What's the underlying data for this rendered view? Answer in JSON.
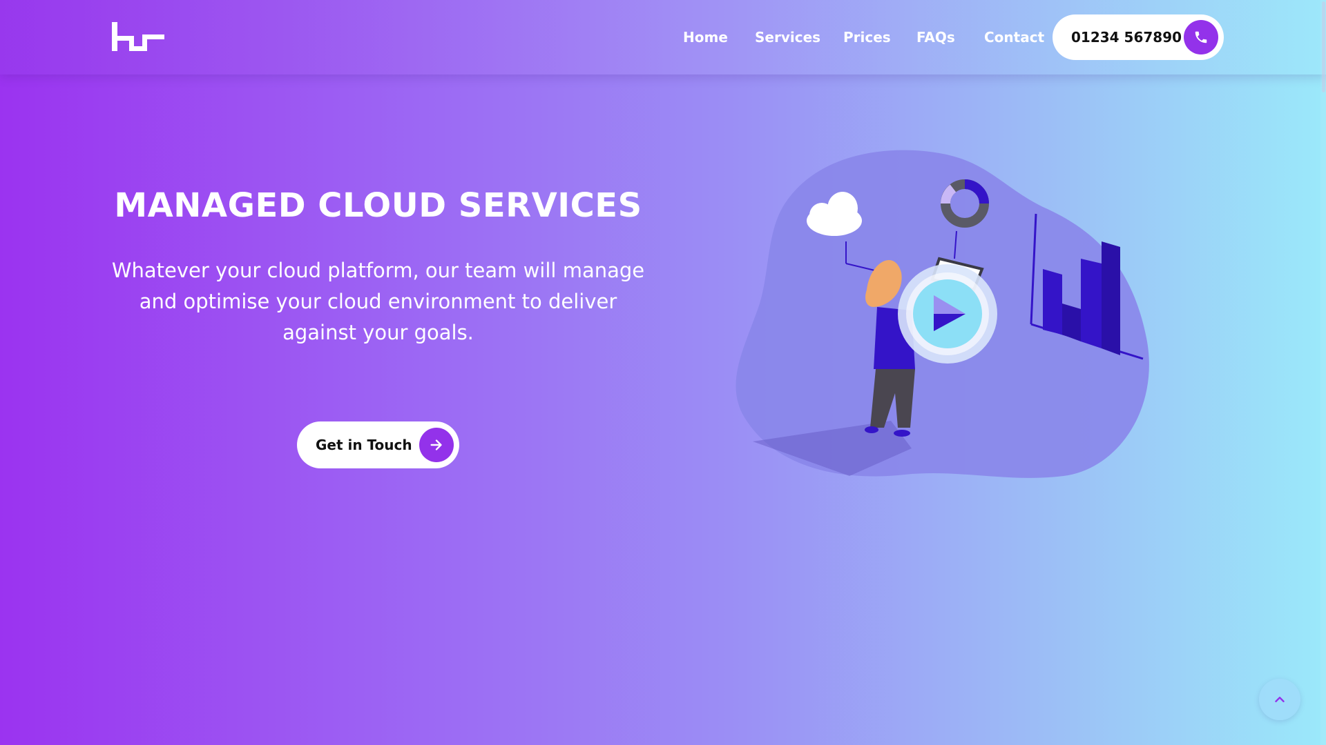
{
  "brand": {
    "logo_icon": "brand-logo-icon"
  },
  "nav": {
    "items": [
      {
        "label": "Home"
      },
      {
        "label": "Services"
      },
      {
        "label": "Prices"
      },
      {
        "label": "FAQs"
      },
      {
        "label": "Contact"
      }
    ],
    "phone": {
      "number": "01234 567890",
      "icon": "phone-icon"
    }
  },
  "hero": {
    "title": "MANAGED CLOUD SERVICES",
    "description": "Whatever your cloud platform, our team will manage and optimise your cloud environment to deliver against your goals.",
    "cta_label": "Get in Touch",
    "cta_icon": "arrow-right-icon",
    "video_icon": "play-icon"
  },
  "scroll_top_icon": "chevron-up-icon",
  "colors": {
    "accent": "#9332ea",
    "gradient_start": "#9b33f0",
    "gradient_end": "#9be9fa",
    "blob": "#8a86ea",
    "chart_bars": "#3414c8"
  }
}
